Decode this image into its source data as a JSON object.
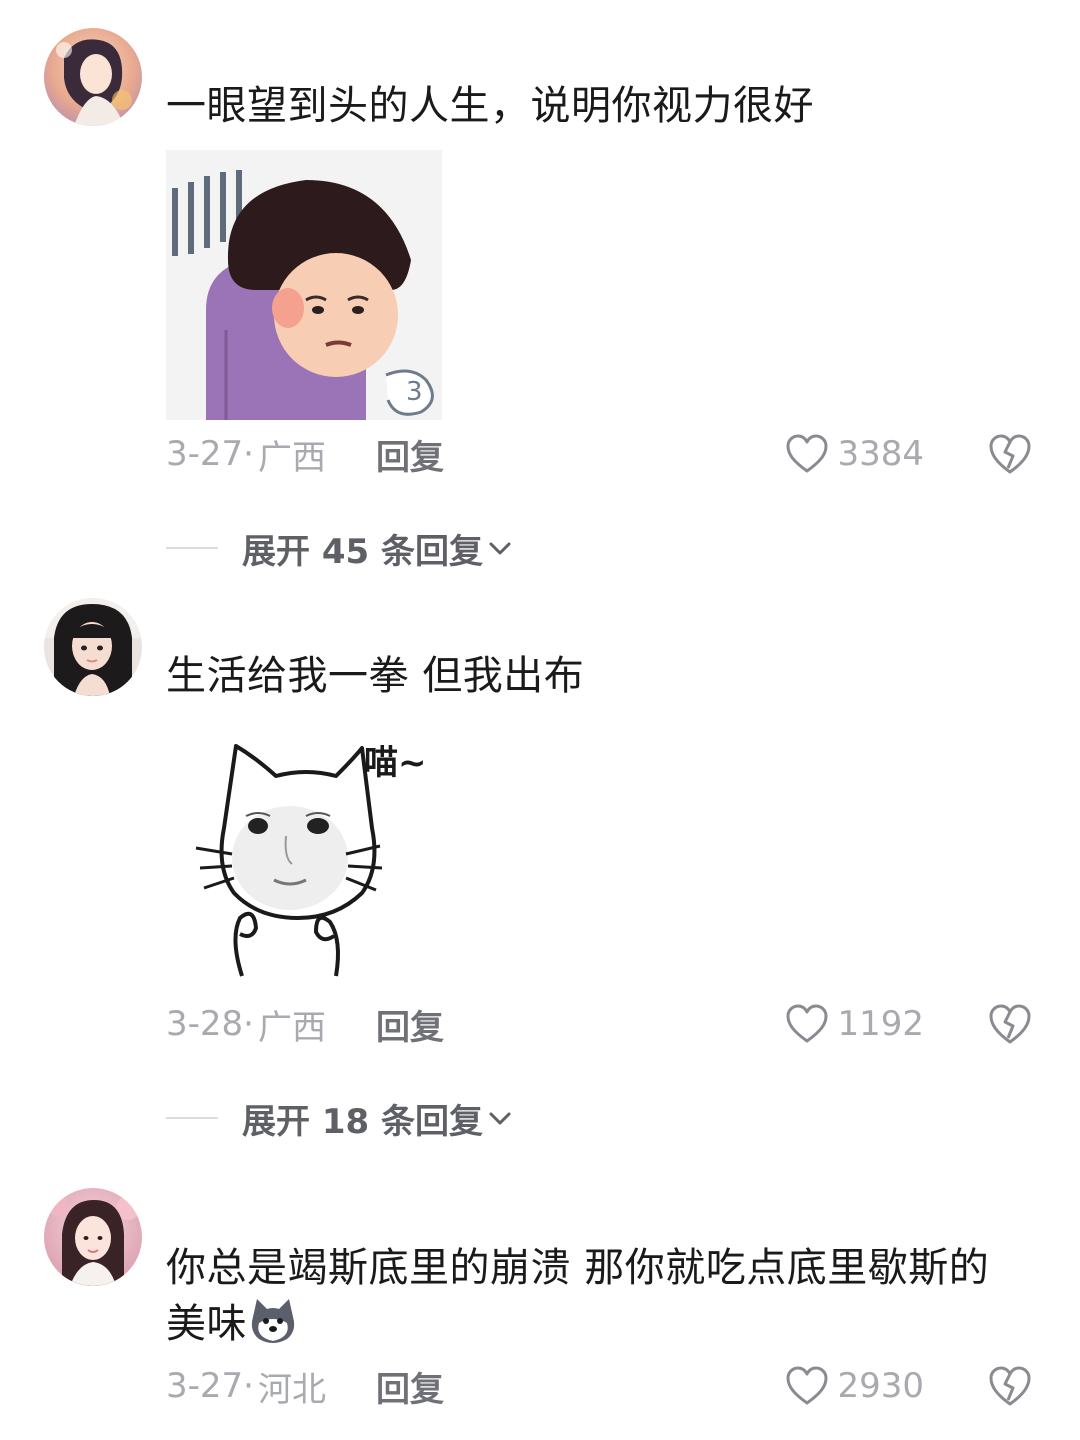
{
  "comments": [
    {
      "text": "一眼望到头的人生，说明你视力很好",
      "date": "3-27·",
      "region": "广西",
      "reply_label": "回复",
      "likes": "3384",
      "sticker": "sticker-purple-shirt-man",
      "expand_label": "展开 45 条回复"
    },
    {
      "text": "生活给我一拳 但我出布",
      "date": "3-28·",
      "region": "广西",
      "reply_label": "回复",
      "likes": "1192",
      "sticker": "sticker-cat-face",
      "sticker_text": "喵~",
      "expand_label": "展开 18 条回复"
    },
    {
      "text_line1": "你总是竭斯底里的崩溃 那你就吃点底里歇斯的",
      "text_line2": "美味",
      "inline_emoji": "dog-emoji",
      "date": "3-27·",
      "region": "河北",
      "reply_label": "回复",
      "likes": "2930"
    }
  ],
  "icons": {
    "like": "heart-outline-icon",
    "dislike": "broken-heart-icon",
    "expand": "chevron-down-icon"
  },
  "colors": {
    "text": "#1a1a1a",
    "meta": "#a9aaaf",
    "reply": "#707176"
  }
}
